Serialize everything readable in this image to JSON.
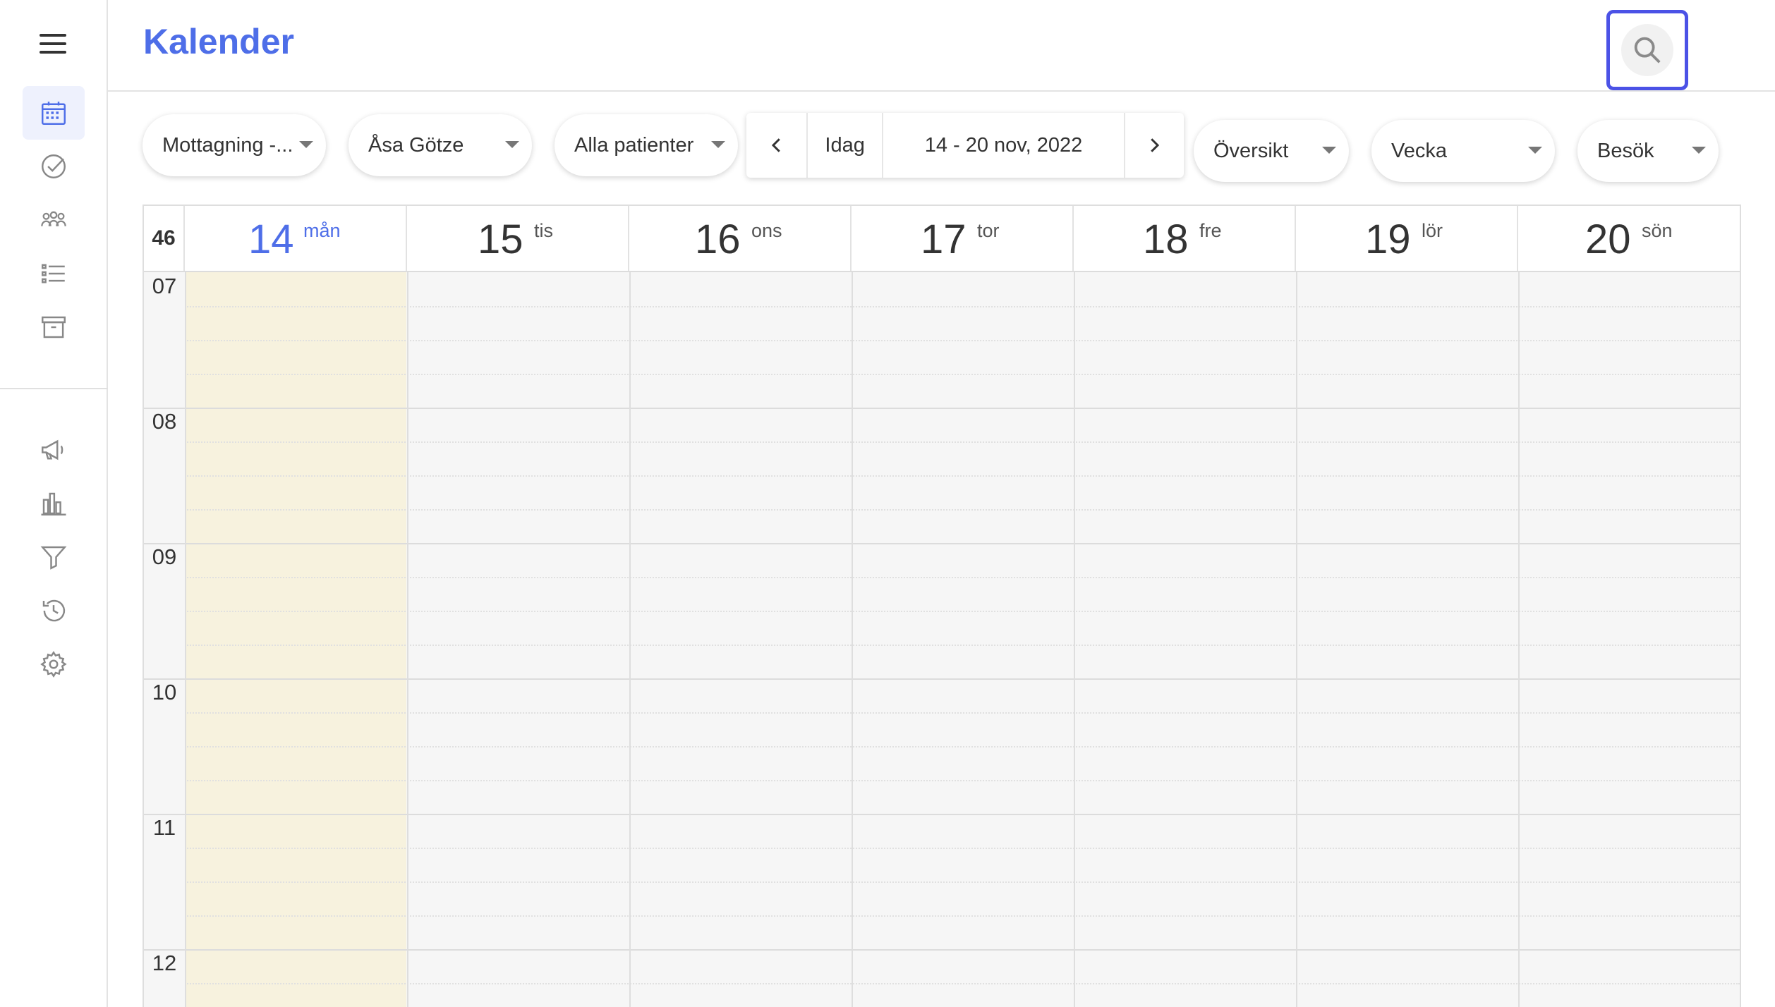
{
  "header": {
    "title": "Kalender"
  },
  "toolbar": {
    "clinic": "Mottagning -...",
    "staff": "Åsa Götze",
    "patients": "Alla patienter",
    "today": "Idag",
    "range": "14 - 20 nov, 2022",
    "view_mode": "Översikt",
    "period": "Vecka",
    "type": "Besök"
  },
  "calendar": {
    "week_number": "46",
    "days": [
      {
        "num": "14",
        "weekday": "mån",
        "today": true
      },
      {
        "num": "15",
        "weekday": "tis"
      },
      {
        "num": "16",
        "weekday": "ons"
      },
      {
        "num": "17",
        "weekday": "tor"
      },
      {
        "num": "18",
        "weekday": "fre"
      },
      {
        "num": "19",
        "weekday": "lör"
      },
      {
        "num": "20",
        "weekday": "sön"
      }
    ],
    "hours": [
      "07",
      "08",
      "09",
      "10",
      "11",
      "12"
    ]
  },
  "sidebar": {
    "items": [
      "calendar-icon",
      "check-circle-icon",
      "people-icon",
      "list-icon",
      "archive-icon",
      "megaphone-icon",
      "bar-chart-icon",
      "filter-icon",
      "history-icon",
      "gear-icon"
    ]
  },
  "colors": {
    "accent": "#4e6ee8",
    "today_bg": "#f7f2de",
    "highlight": "#4b52e6"
  }
}
